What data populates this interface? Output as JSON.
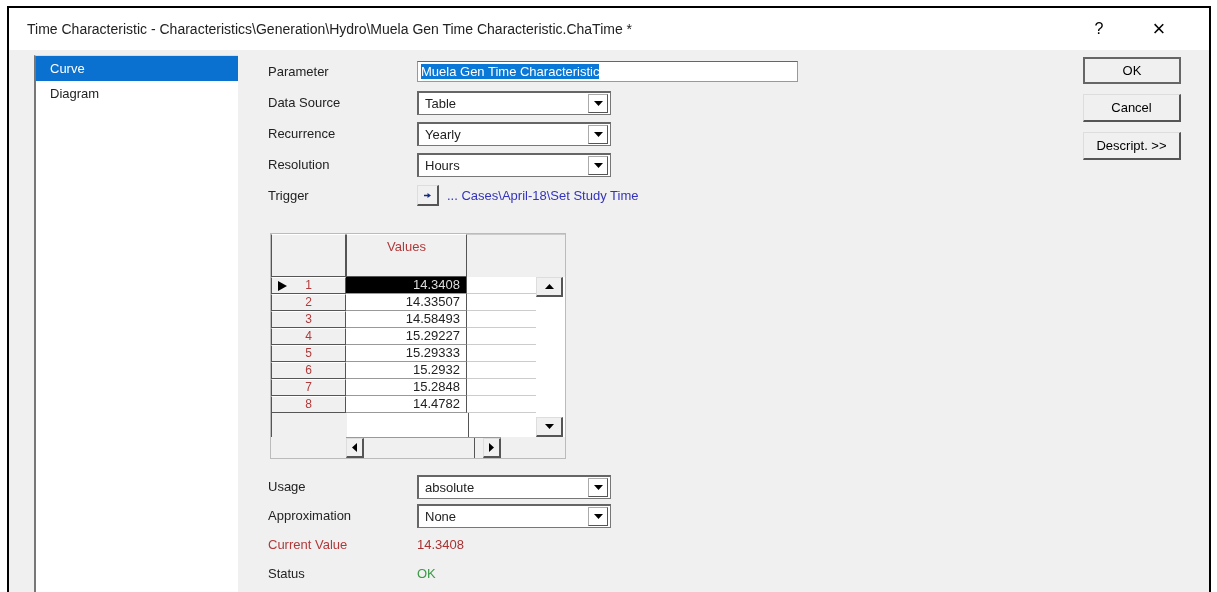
{
  "window": {
    "title": "Time Characteristic - Characteristics\\Generation\\Hydro\\Muela Gen Time Characteristic.ChaTime *",
    "help": "?",
    "close": "×"
  },
  "sidebar": {
    "items": [
      {
        "label": "Curve",
        "selected": true
      },
      {
        "label": "Diagram",
        "selected": false
      }
    ]
  },
  "fields": [
    {
      "kind": "text",
      "label": "Parameter",
      "value": "Muela Gen Time Characteristic",
      "text_selected": true
    },
    {
      "kind": "dropdown",
      "label": "Data Source",
      "value": "Table"
    },
    {
      "kind": "dropdown",
      "label": "Recurrence",
      "value": "Yearly"
    },
    {
      "kind": "dropdown",
      "label": "Resolution",
      "value": "Hours"
    },
    {
      "kind": "trigger",
      "label": "Trigger",
      "value": "... Cases\\April-18\\Set Study Time"
    }
  ],
  "table": {
    "columns": [
      "Values"
    ],
    "rows": [
      {
        "index": "1",
        "value": "14.3408",
        "selected": true
      },
      {
        "index": "2",
        "value": "14.33507",
        "selected": false
      },
      {
        "index": "3",
        "value": "14.58493",
        "selected": false
      },
      {
        "index": "4",
        "value": "15.29227",
        "selected": false
      },
      {
        "index": "5",
        "value": "15.29333",
        "selected": false
      },
      {
        "index": "6",
        "value": "15.2932",
        "selected": false
      },
      {
        "index": "7",
        "value": "15.2848",
        "selected": false
      },
      {
        "index": "8",
        "value": "14.4782",
        "selected": false
      }
    ]
  },
  "lower_fields": [
    {
      "kind": "dropdown",
      "label": "Usage",
      "value": "absolute"
    },
    {
      "kind": "dropdown",
      "label": "Approximation",
      "value": "None"
    },
    {
      "kind": "reading",
      "label": "Current Value",
      "value": "14.3408",
      "color": "#a83232"
    },
    {
      "kind": "reading",
      "label": "Status",
      "value": "OK",
      "color": "#3a9a44"
    }
  ],
  "buttons": [
    "OK",
    "Cancel",
    "Descript. >>"
  ]
}
